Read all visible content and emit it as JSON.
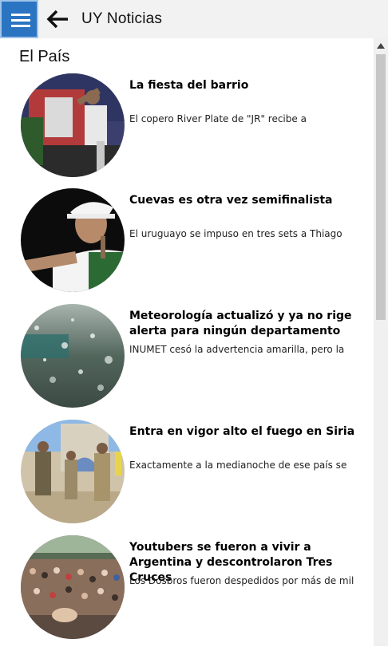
{
  "header": {
    "menu_icon": "hamburger-menu-icon",
    "back_icon": "back-arrow-icon",
    "title": "UY Noticias",
    "accent_color": "#2b74c2"
  },
  "section": {
    "title": "El País"
  },
  "articles": [
    {
      "headline": "La fiesta del barrio",
      "summary": "El copero River Plate de \"JR\" recibe a",
      "image": "soccer-player-celebrating"
    },
    {
      "headline": "Cuevas es otra vez semifinalista",
      "summary": "El uruguayo se impuso en tres sets a Thiago",
      "image": "tennis-player"
    },
    {
      "headline": "Meteorología actualizó y ya no rige alerta para ningún departamento",
      "summary": "INUMET cesó la advertencia amarilla, pero la",
      "image": "rain-on-window"
    },
    {
      "headline": "Entra en vigor alto el fuego en Siria",
      "summary": "Exactamente a la medianoche de ese país se",
      "image": "soldiers-in-street"
    },
    {
      "headline": "Youtubers se fueron a vivir a Argentina y descontrolaron Tres Cruces",
      "summary": "Los Dosbros fueron despedidos por más de mil",
      "image": "crowd-of-fans"
    }
  ]
}
